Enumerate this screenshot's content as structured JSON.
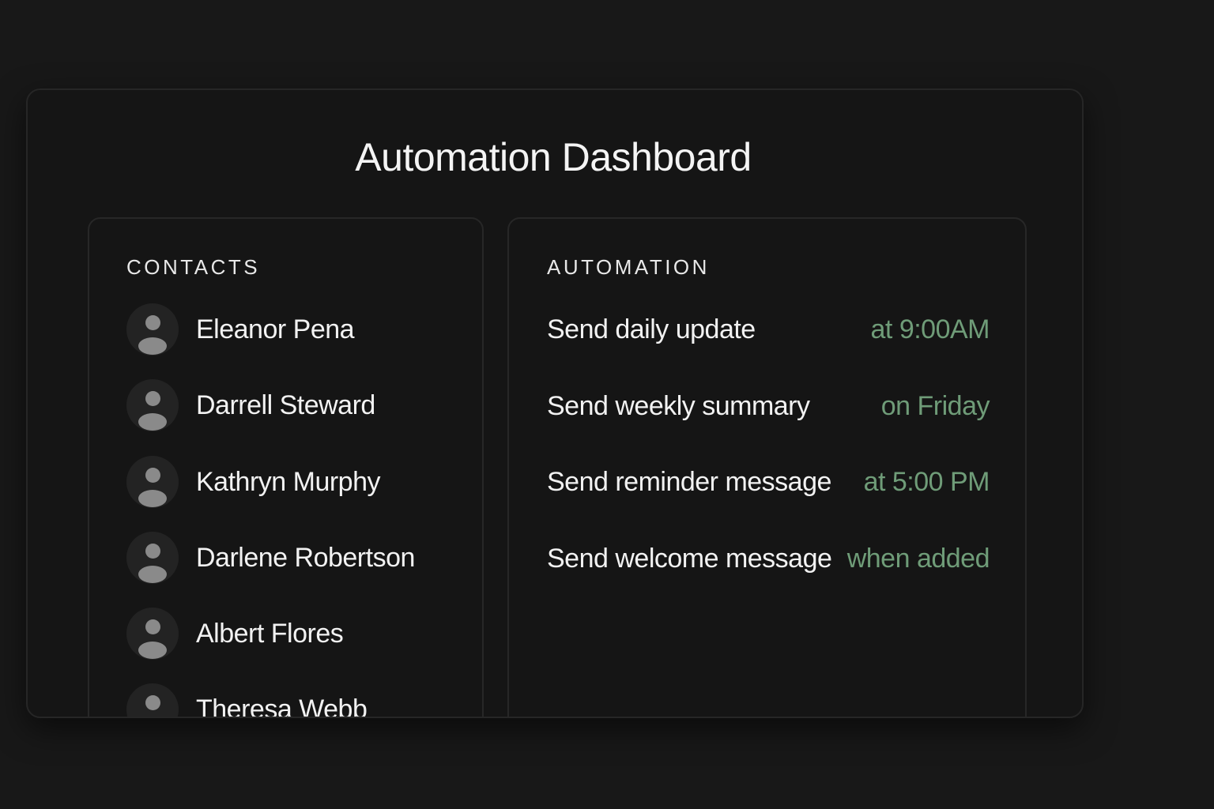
{
  "dashboard": {
    "title": "Automation Dashboard"
  },
  "contacts": {
    "heading": "CONTACTS",
    "items": [
      {
        "name": "Eleanor Pena",
        "icon": "user-avatar-icon"
      },
      {
        "name": "Darrell Steward",
        "icon": "user-avatar-icon"
      },
      {
        "name": "Kathryn Murphy",
        "icon": "user-avatar-icon"
      },
      {
        "name": "Darlene Robertson",
        "icon": "user-avatar-icon"
      },
      {
        "name": "Albert Flores",
        "icon": "user-avatar-icon"
      },
      {
        "name": "Theresa Webb",
        "icon": "user-avatar-icon"
      }
    ]
  },
  "automation": {
    "heading": "AUTOMATION",
    "rules": [
      {
        "action": "Send daily update",
        "trigger": "at 9:00AM"
      },
      {
        "action": "Send weekly summary",
        "trigger": "on Friday"
      },
      {
        "action": "Send reminder message",
        "trigger": "at 5:00 PM"
      },
      {
        "action": "Send welcome message",
        "trigger": "when added"
      }
    ]
  },
  "colors": {
    "background": "#181818",
    "panel": "#151515",
    "border": "#272727",
    "text": "#f2f2f2",
    "accent_green": "#6f9c78",
    "avatar_fill": "#8a8a8a"
  }
}
